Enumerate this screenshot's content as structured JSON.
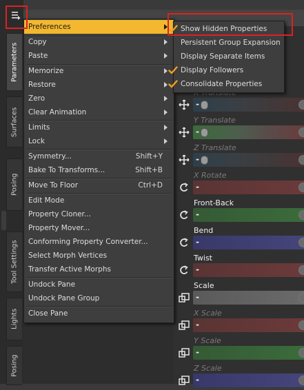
{
  "colors": {
    "highlight": "#f3b82f",
    "menu_bg": "#3e3e3e",
    "annotation_red": "#e02020",
    "check_orange": "#f0a020"
  },
  "pane_menu_button": {
    "icon": "pane-options-icon"
  },
  "side_tabs": [
    "Parameters",
    "Surfaces",
    "Posing",
    "Tool Settings",
    "Lights",
    "Posing"
  ],
  "context_menu": {
    "items": [
      {
        "label": "Preferences",
        "submenu": true,
        "highlighted": true
      },
      {
        "label": "Copy",
        "submenu": true
      },
      {
        "label": "Paste",
        "submenu": true
      },
      {
        "label": "Memorize",
        "submenu": true
      },
      {
        "label": "Restore",
        "submenu": true
      },
      {
        "label": "Zero",
        "submenu": true
      },
      {
        "label": "Clear Animation",
        "submenu": true
      },
      {
        "label": "Limits",
        "submenu": true
      },
      {
        "label": "Lock",
        "submenu": true
      },
      {
        "label": "Symmetry...",
        "shortcut": "Shift+Y"
      },
      {
        "label": "Bake To Transforms...",
        "shortcut": "Shift+B"
      },
      {
        "label": "Move To Floor",
        "shortcut": "Ctrl+D"
      },
      {
        "label": "Edit Mode"
      },
      {
        "label": "Property Cloner..."
      },
      {
        "label": "Property Mover..."
      },
      {
        "label": "Conforming Property Converter..."
      },
      {
        "label": "Select Morph Vertices"
      },
      {
        "label": "Transfer Active Morphs"
      },
      {
        "label": "Undock Pane"
      },
      {
        "label": "Undock Pane Group"
      },
      {
        "label": "Close Pane"
      }
    ]
  },
  "preferences_submenu": {
    "items": [
      {
        "label": "Show Hidden Properties",
        "checked": true
      },
      {
        "label": "Persistent Group Expansion",
        "checked": false
      },
      {
        "label": "Display Separate Items",
        "checked": false
      },
      {
        "label": "Display Followers",
        "checked": true
      },
      {
        "label": "Consolidate Properties",
        "checked": true
      }
    ]
  },
  "parameters": [
    {
      "label": "X Translate",
      "hidden": true,
      "icon": "translate-icon"
    },
    {
      "label": "Y Translate",
      "hidden": true,
      "icon": "translate-icon"
    },
    {
      "label": "Z Translate",
      "hidden": true,
      "icon": "translate-icon"
    },
    {
      "label": "X Rotate",
      "hidden": true,
      "icon": "rotate-icon"
    },
    {
      "label": "Front-Back",
      "hidden": false,
      "icon": "rotate-icon"
    },
    {
      "label": "Bend",
      "hidden": false,
      "icon": "rotate-icon"
    },
    {
      "label": "Twist",
      "hidden": false,
      "icon": "rotate-icon"
    },
    {
      "label": "Scale",
      "hidden": false,
      "icon": "scale-icon"
    },
    {
      "label": "X Scale",
      "hidden": true,
      "icon": "scale-icon"
    },
    {
      "label": "Y Scale",
      "hidden": true,
      "icon": "scale-icon"
    },
    {
      "label": "Z Scale",
      "hidden": true,
      "icon": "scale-icon"
    }
  ],
  "slider_minus": "-"
}
